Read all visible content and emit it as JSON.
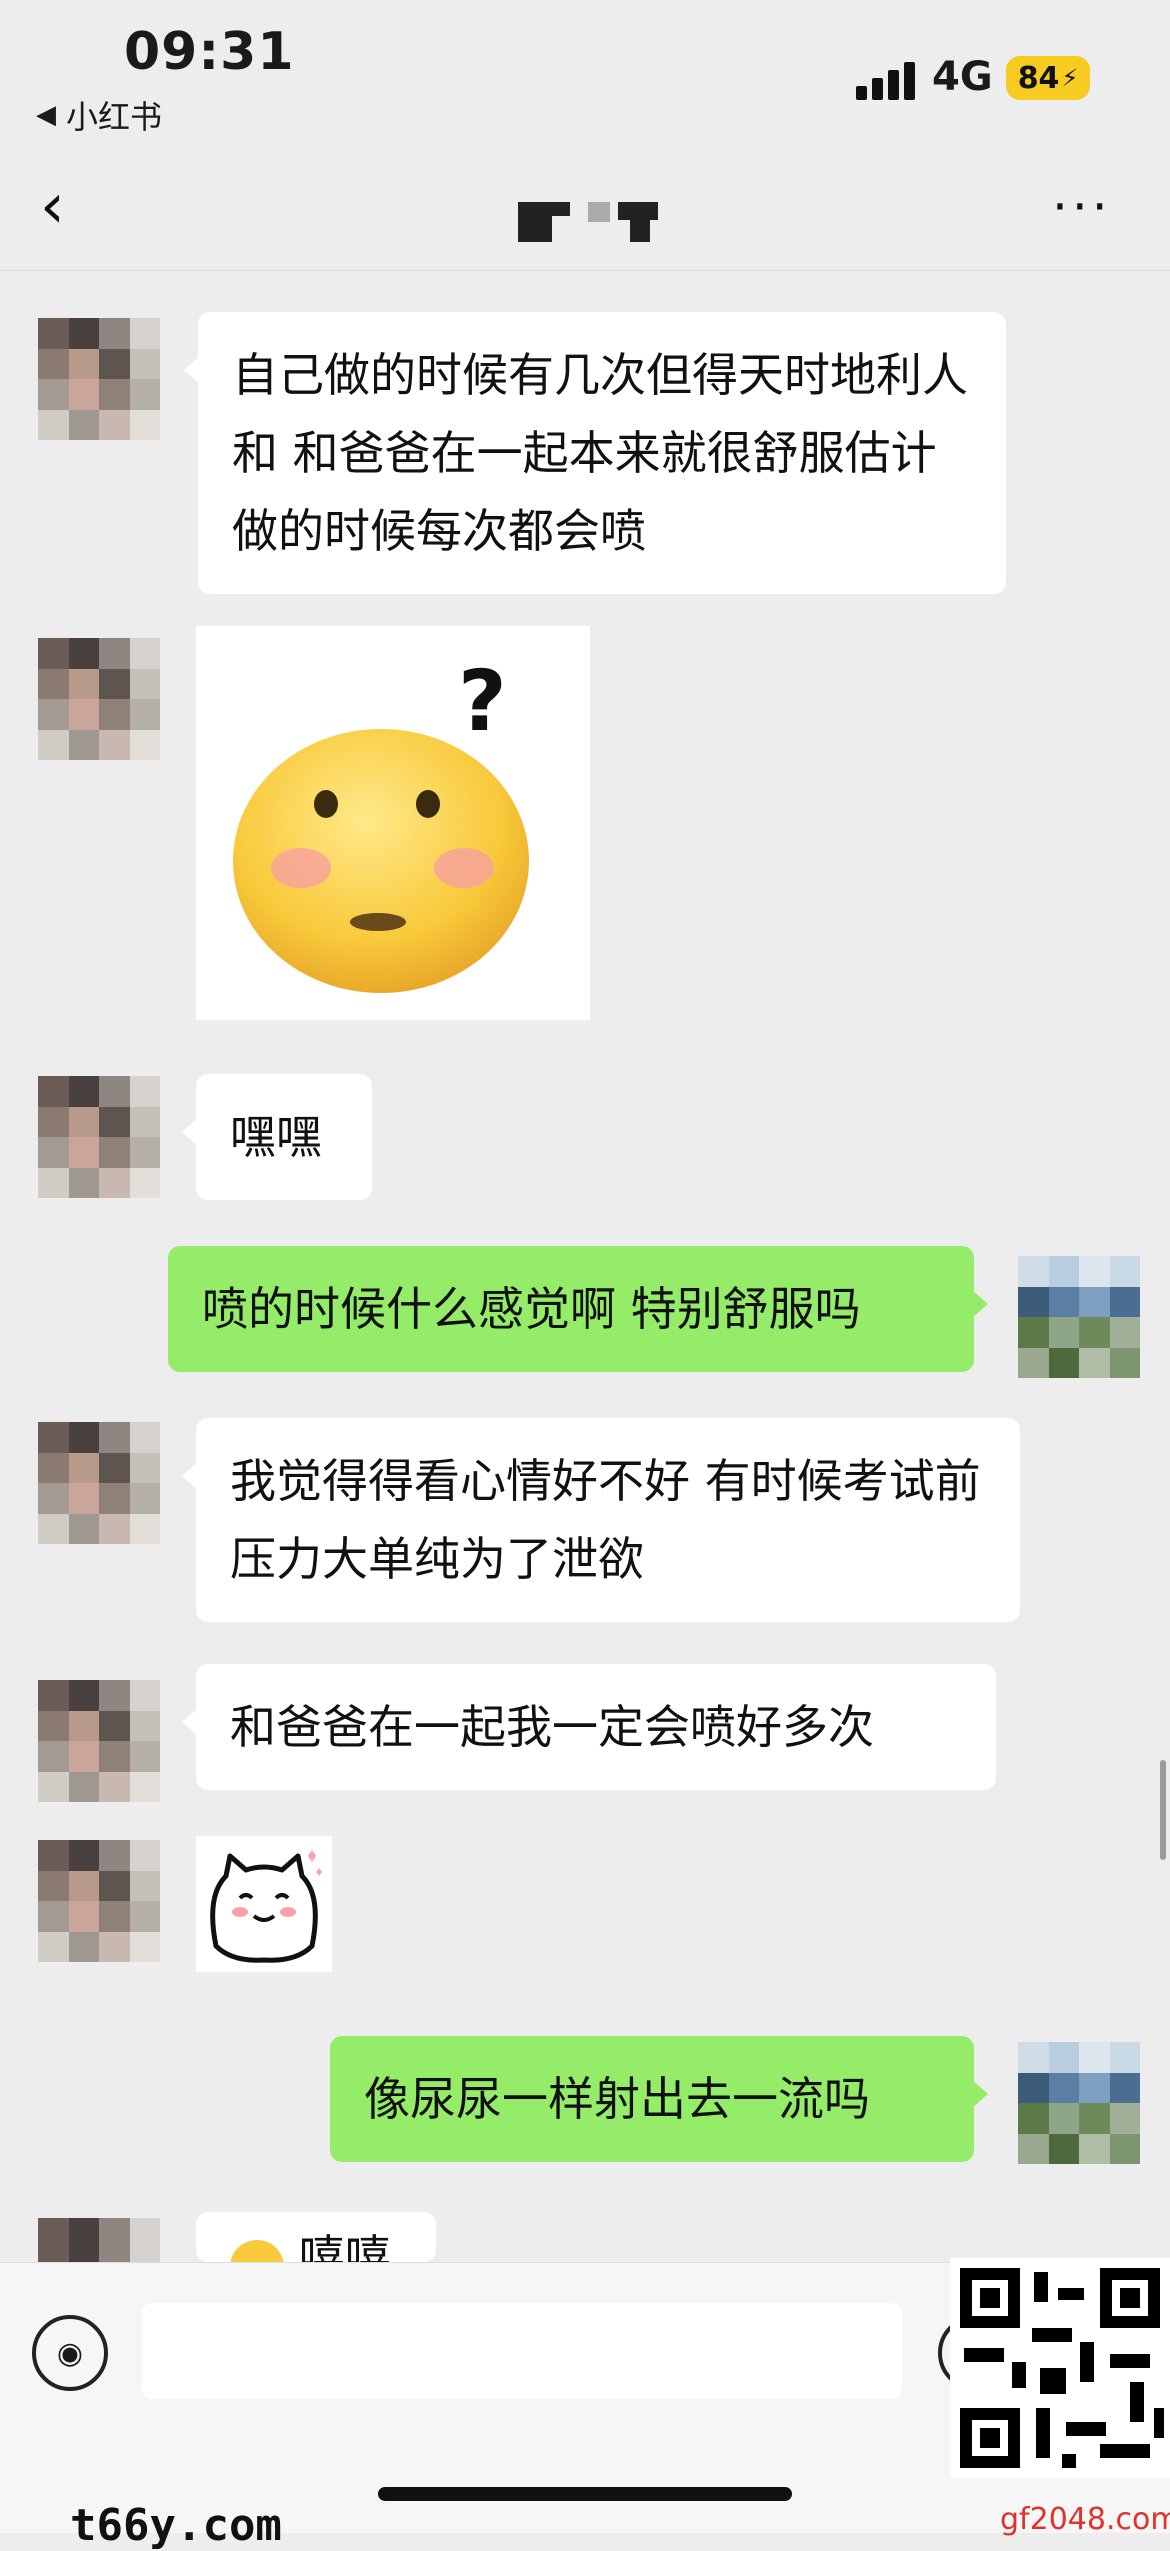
{
  "status_bar": {
    "time": "09:31",
    "back_app": "小红书",
    "network": "4G",
    "battery": "84"
  },
  "nav": {
    "more": "···"
  },
  "messages": [
    {
      "side": "in",
      "type": "text",
      "text": "自己做的时候有几次但得天时地利人和 和爸爸在一起本来就很舒服估计做的时候每次都会喷"
    },
    {
      "side": "in",
      "type": "sticker",
      "sticker": "confused-emoji-sticker",
      "text": "?"
    },
    {
      "side": "in",
      "type": "text",
      "text": "嘿嘿"
    },
    {
      "side": "out",
      "type": "text",
      "text": "喷的时候什么感觉啊 特别舒服吗"
    },
    {
      "side": "in",
      "type": "text",
      "text": "我觉得得看心情好不好 有时候考试前压力大单纯为了泄欲"
    },
    {
      "side": "in",
      "type": "text",
      "text": "和爸爸在一起我一定会喷好多次"
    },
    {
      "side": "in",
      "type": "sticker",
      "sticker": "shy-cat-sticker"
    },
    {
      "side": "out",
      "type": "text",
      "text": "像尿尿一样射出去一流吗"
    },
    {
      "side": "in",
      "type": "text",
      "text": "嘻嘻"
    }
  ],
  "watermark": {
    "left": "t66y.com",
    "right": "gf2048.com"
  },
  "colors": {
    "background": "#ededed",
    "outgoing_bubble": "#95ec69",
    "incoming_bubble": "#ffffff",
    "battery": "#f7cb1f"
  }
}
